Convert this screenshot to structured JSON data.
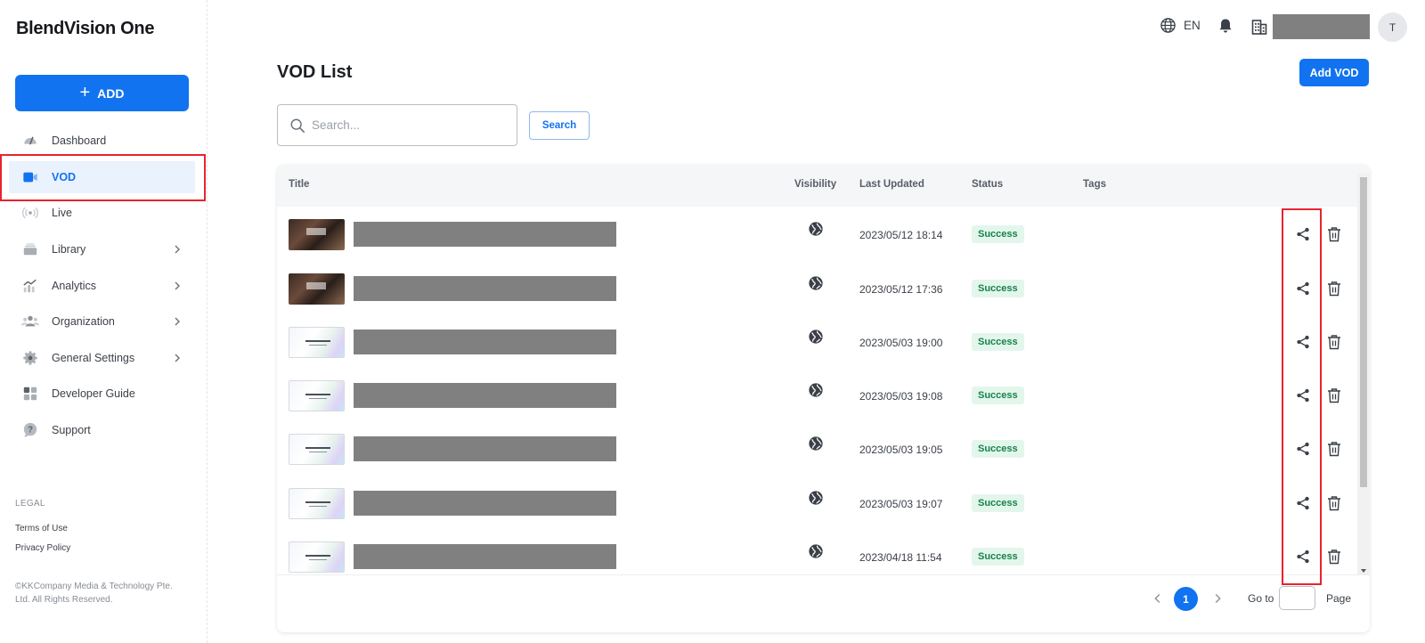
{
  "app": {
    "logo": "BlendVision One"
  },
  "sidebar": {
    "add_label": "ADD",
    "items": [
      {
        "label": "Dashboard",
        "icon": "dashboard-gauge-icon",
        "has_chevron": false
      },
      {
        "label": "VOD",
        "icon": "video-camera-icon",
        "has_chevron": false,
        "active": true
      },
      {
        "label": "Live",
        "icon": "live-broadcast-icon",
        "has_chevron": false
      },
      {
        "label": "Library",
        "icon": "library-stack-icon",
        "has_chevron": true
      },
      {
        "label": "Analytics",
        "icon": "analytics-chart-icon",
        "has_chevron": true
      },
      {
        "label": "Organization",
        "icon": "organization-people-icon",
        "has_chevron": true
      },
      {
        "label": "General Settings",
        "icon": "gear-icon",
        "has_chevron": true
      },
      {
        "label": "Developer Guide",
        "icon": "grid-apps-icon",
        "has_chevron": false
      },
      {
        "label": "Support",
        "icon": "question-circle-icon",
        "has_chevron": false
      }
    ],
    "legal_heading": "LEGAL",
    "terms": "Terms of Use",
    "privacy": "Privacy Policy",
    "copyright": "©KKCompany Media & Technology Pte. Ltd. All Rights Reserved."
  },
  "topbar": {
    "language": "EN",
    "avatar_initial": "T"
  },
  "main": {
    "title": "VOD List",
    "add_button": "Add VOD",
    "search": {
      "placeholder": "Search...",
      "value": "",
      "button": "Search"
    },
    "columns": {
      "title": "Title",
      "visibility": "Visibility",
      "last_updated": "Last Updated",
      "status": "Status",
      "tags": "Tags"
    },
    "rows": [
      {
        "thumb": "dark",
        "updated": "2023/05/12 18:14",
        "status": "Success"
      },
      {
        "thumb": "dark",
        "updated": "2023/05/12 17:36",
        "status": "Success"
      },
      {
        "thumb": "light",
        "updated": "2023/05/03 19:00",
        "status": "Success"
      },
      {
        "thumb": "light",
        "updated": "2023/05/03 19:08",
        "status": "Success"
      },
      {
        "thumb": "light",
        "updated": "2023/05/03 19:05",
        "status": "Success"
      },
      {
        "thumb": "light",
        "updated": "2023/05/03 19:07",
        "status": "Success"
      },
      {
        "thumb": "light",
        "updated": "2023/04/18 11:54",
        "status": "Success"
      }
    ],
    "pagination": {
      "current": "1",
      "goto_label": "Go to",
      "page_label": "Page",
      "goto_value": ""
    }
  },
  "colors": {
    "accent": "#1173f0",
    "success_bg": "#e3f6ec",
    "success_text": "#17824a",
    "highlight": "#e8232f"
  }
}
